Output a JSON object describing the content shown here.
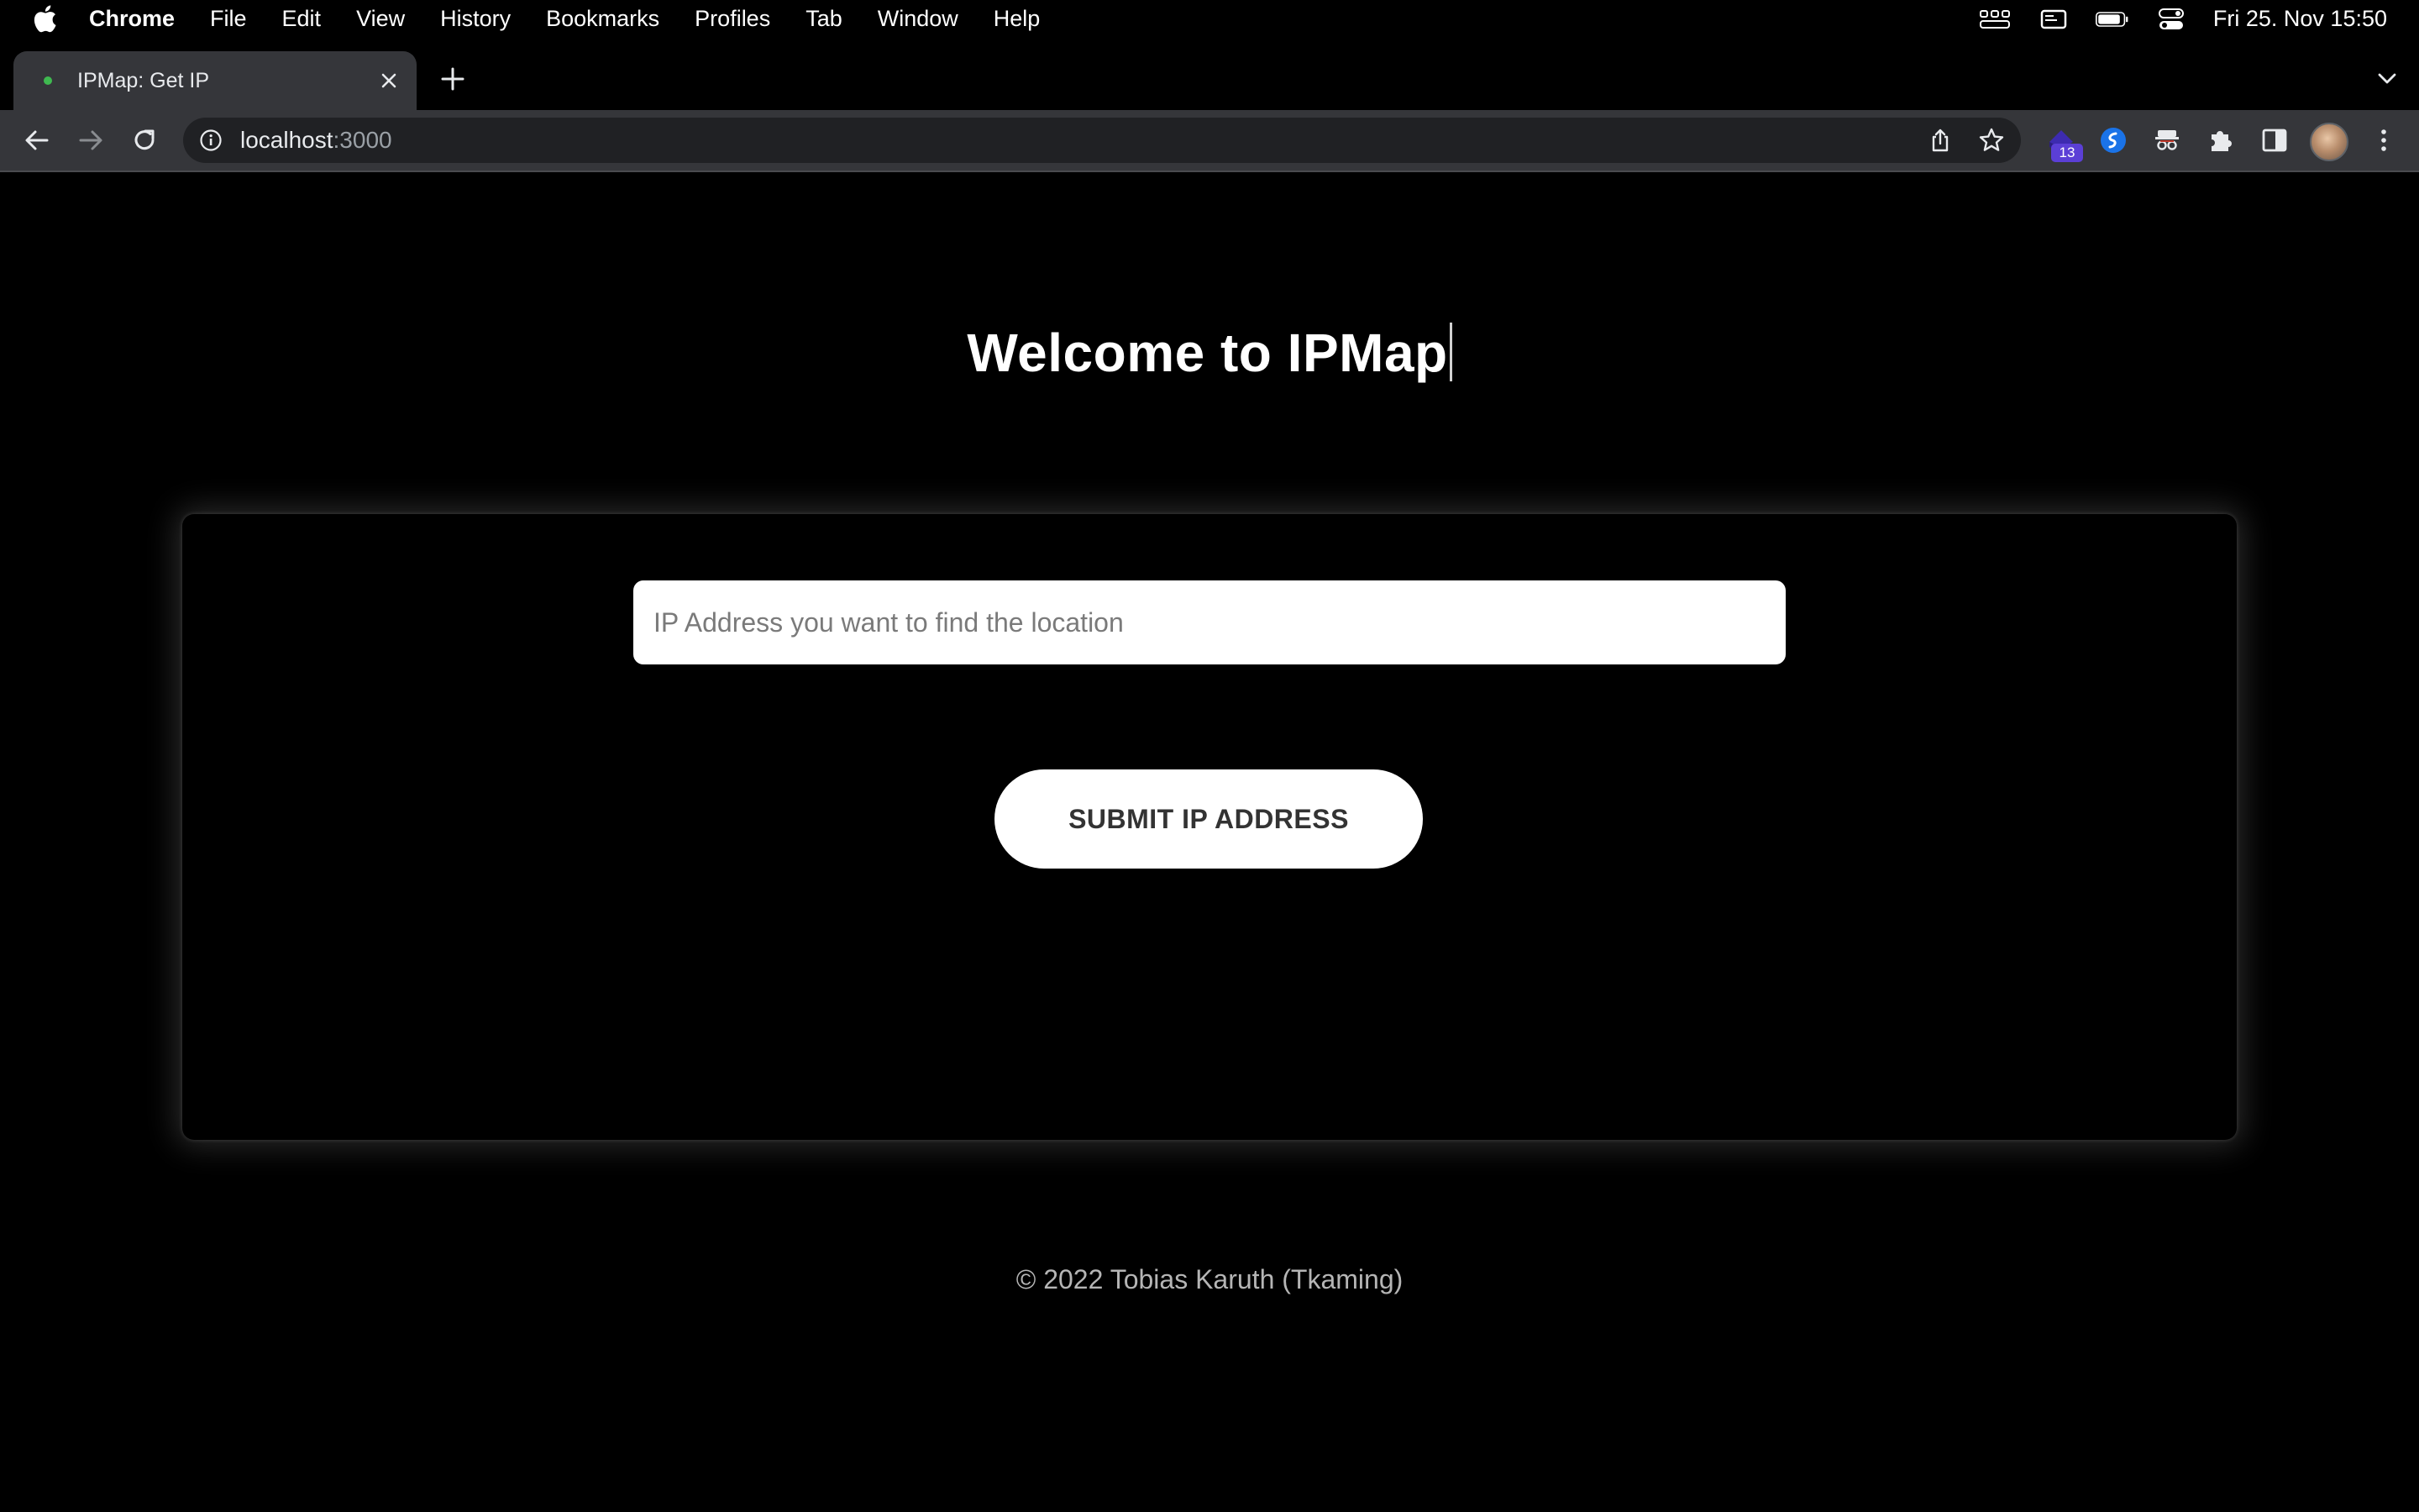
{
  "menubar": {
    "app_name": "Chrome",
    "items": [
      "File",
      "Edit",
      "View",
      "History",
      "Bookmarks",
      "Profiles",
      "Tab",
      "Window",
      "Help"
    ],
    "clock": "Fri 25. Nov  15:50"
  },
  "browser": {
    "tab_title": "IPMap: Get IP",
    "url_host": "localhost",
    "url_port": ":3000",
    "extension_badge": "13"
  },
  "page": {
    "heading": "Welcome to IPMap",
    "input_placeholder": "IP Address you want to find the location",
    "input_value": "",
    "submit_label": "SUBMIT IP ADDRESS",
    "footer": "© 2022 Tobias Karuth (Tkaming)"
  }
}
